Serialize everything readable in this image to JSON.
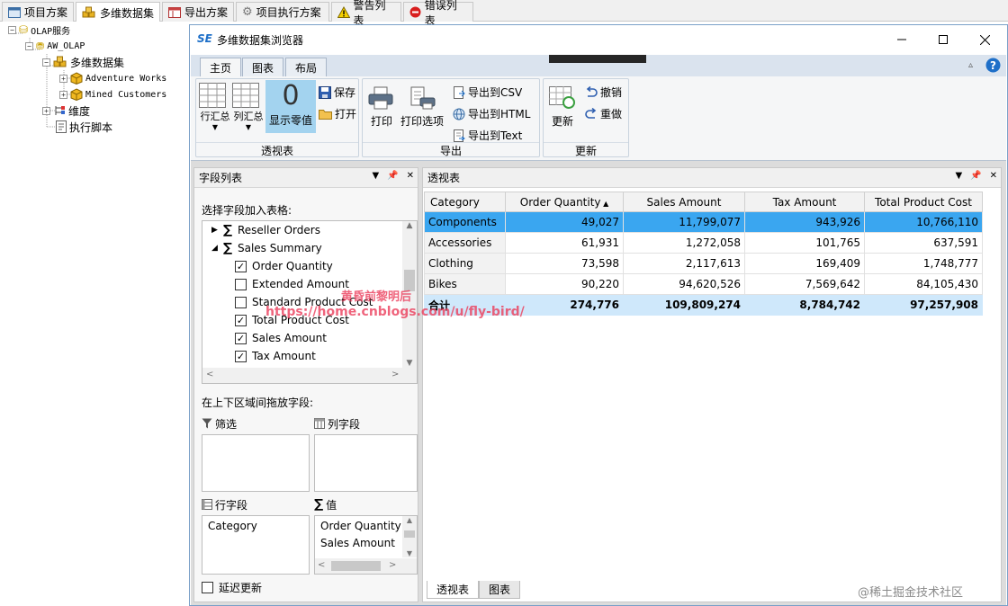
{
  "top_tabs": [
    "项目方案",
    "多维数据集",
    "导出方案",
    "项目执行方案",
    "警告列表",
    "错误列表"
  ],
  "tree": {
    "root": "OLAP服务",
    "db": "AW_OLAP",
    "cubes_folder": "多维数据集",
    "cube1": "Adventure Works",
    "cube2": "Mined Customers",
    "dim": "维度",
    "script": "执行脚本"
  },
  "window": {
    "logo": "SE",
    "title": "多维数据集浏览器"
  },
  "ribbon": {
    "tabs": [
      "主页",
      "图表",
      "布局"
    ],
    "pivot": {
      "row_total": "行汇总",
      "col_total": "列汇总",
      "zero_value": "0",
      "show_zero": "显示零值",
      "save": "保存",
      "open": "打开",
      "label": "透视表"
    },
    "export": {
      "print": "打印",
      "print_opts": "打印选项",
      "csv": "导出到CSV",
      "html": "导出到HTML",
      "text": "导出到Text",
      "label": "导出"
    },
    "update": {
      "refresh": "更新",
      "undo": "撤销",
      "redo": "重做",
      "label": "更新"
    }
  },
  "field_panel": {
    "title": "字段列表",
    "choose_label": "选择字段加入表格:",
    "groups": [
      {
        "name": "Reseller Orders"
      },
      {
        "name": "Sales Summary"
      }
    ],
    "fields": [
      {
        "label": "Order Quantity",
        "checked": true
      },
      {
        "label": "Extended Amount",
        "checked": false
      },
      {
        "label": "Standard Product Cost",
        "checked": false
      },
      {
        "label": "Total Product Cost",
        "checked": true
      },
      {
        "label": "Sales Amount",
        "checked": true
      },
      {
        "label": "Tax Amount",
        "checked": true
      }
    ],
    "drag_label": "在上下区域间拖放字段:",
    "filter": "筛选",
    "col_fields": "列字段",
    "row_fields": "行字段",
    "values": "值",
    "row_items": [
      "Category"
    ],
    "value_items": [
      "Order Quantity",
      "Sales Amount"
    ],
    "defer": "延迟更新"
  },
  "pivot_panel": {
    "title": "透视表",
    "headers": [
      "Category",
      "Order Quantity",
      "Sales Amount",
      "Tax Amount",
      "Total Product Cost"
    ],
    "rows": [
      [
        "Components",
        "49,027",
        "11,799,077",
        "943,926",
        "10,766,110"
      ],
      [
        "Accessories",
        "61,931",
        "1,272,058",
        "101,765",
        "637,591"
      ],
      [
        "Clothing",
        "73,598",
        "2,117,613",
        "169,409",
        "1,748,777"
      ],
      [
        "Bikes",
        "90,220",
        "94,620,526",
        "7,569,642",
        "84,105,430"
      ]
    ],
    "total": [
      "合计",
      "274,776",
      "109,809,274",
      "8,784,742",
      "97,257,908"
    ],
    "bottom_tabs": [
      "透视表",
      "图表"
    ]
  },
  "watermark": {
    "text1": "黄昏前黎明后",
    "text2": "https://home.cnblogs.com/u/fly-bird/",
    "corner": "@稀土掘金技术社区"
  }
}
